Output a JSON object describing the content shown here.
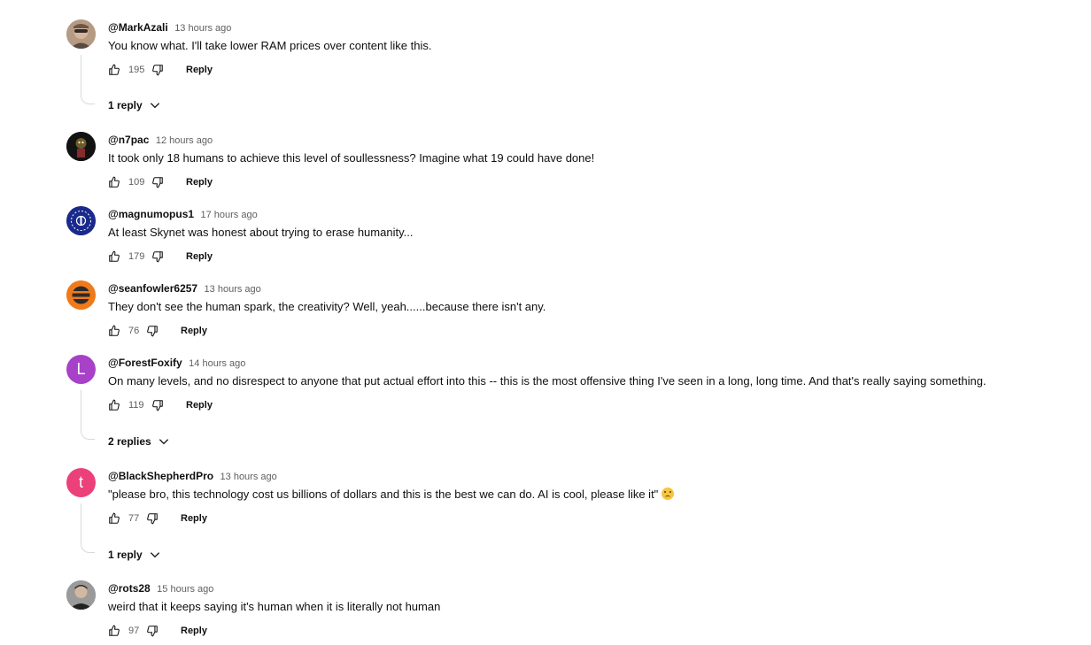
{
  "comments": [
    {
      "author": "@MarkAzali",
      "time": "13 hours ago",
      "text": "You know what. I'll take lower RAM prices over content like this.",
      "likes": "195",
      "reply_label": "Reply",
      "replies_label": "1 reply",
      "avatar_icon": "user-photo-glasses"
    },
    {
      "author": "@n7pac",
      "time": "12 hours ago",
      "text": "It took only 18 humans to achieve this level of soullessness? Imagine what 19 could have done!",
      "likes": "109",
      "reply_label": "Reply",
      "avatar_icon": "dark-character-avatar"
    },
    {
      "author": "@magnumopus1",
      "time": "17 hours ago",
      "text": "At least Skynet was honest about trying to erase humanity...",
      "likes": "179",
      "reply_label": "Reply",
      "avatar_icon": "magnum-opus-logo",
      "avatar_color": "#1a2a8c"
    },
    {
      "author": "@seanfowler6257",
      "time": "13 hours ago",
      "text": "They don't see the human spark, the creativity? Well, yeah......because there isn't any.",
      "likes": "76",
      "reply_label": "Reply",
      "avatar_icon": "orange-stripes-logo",
      "avatar_color": "#f07a1a"
    },
    {
      "author": "@ForestFoxify",
      "time": "14 hours ago",
      "text": "On many levels, and no disrespect to anyone that put actual effort into this -- this is the most offensive thing I've seen in a long, long time. And that's really saying something.",
      "likes": "119",
      "reply_label": "Reply",
      "replies_label": "2 replies",
      "avatar_letter": "L",
      "avatar_color": "#a641c8"
    },
    {
      "author": "@BlackShepherdPro",
      "time": "13 hours ago",
      "text": "\"please bro, this technology cost us billions of dollars and this is the best we can do. AI is cool, please like it\"",
      "emoji": "crying-face-emoji",
      "likes": "77",
      "reply_label": "Reply",
      "replies_label": "1 reply",
      "avatar_letter": "t",
      "avatar_color": "#ec407a"
    },
    {
      "author": "@rots28",
      "time": "15 hours ago",
      "text": "weird that it keeps saying it's human when it is literally not human",
      "likes": "97",
      "reply_label": "Reply",
      "avatar_icon": "user-photo-man"
    }
  ],
  "icons": {
    "like": "thumb-up-icon",
    "dislike": "thumb-down-icon",
    "expand": "chevron-down-icon"
  },
  "colors": {
    "text": "#0f0f0f",
    "secondary": "#606060",
    "thread_line": "#d9d9d9"
  }
}
